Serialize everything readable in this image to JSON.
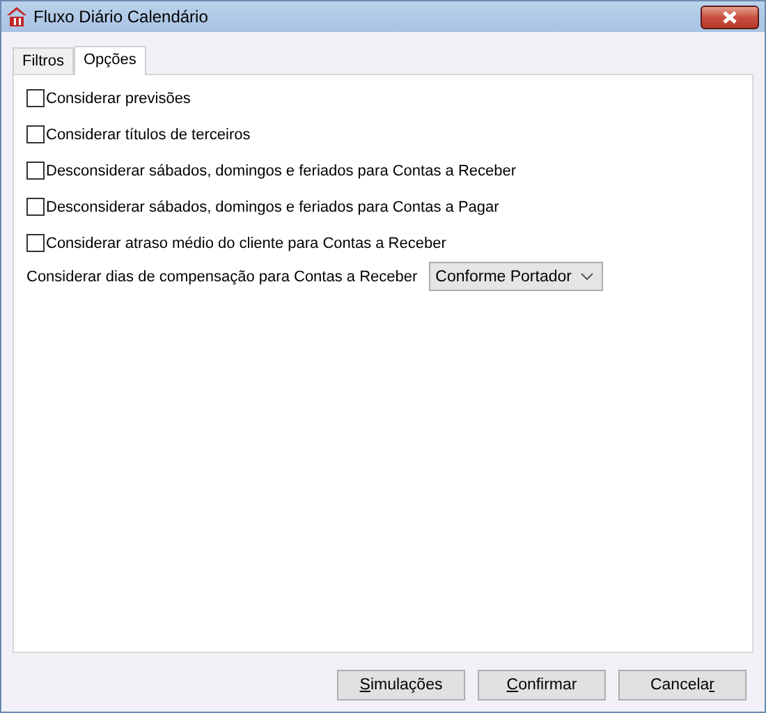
{
  "window": {
    "title": "Fluxo Diário Calendário"
  },
  "tabs": [
    {
      "label": "Filtros",
      "selected": false
    },
    {
      "label": "Opções",
      "selected": true
    }
  ],
  "options": [
    {
      "label": "Considerar previsões",
      "checked": false
    },
    {
      "label": "Considerar títulos de terceiros",
      "checked": false
    },
    {
      "label": "Desconsiderar sábados, domingos e feriados para Contas a Receber",
      "checked": false
    },
    {
      "label": "Desconsiderar sábados, domingos e feriados para Contas a Pagar",
      "checked": false
    },
    {
      "label": "Considerar atraso médio do cliente para Contas a Receber",
      "checked": false
    }
  ],
  "compensation": {
    "label": "Considerar dias de compensação para Contas a Receber",
    "value": "Conforme Portador"
  },
  "buttons": [
    {
      "access_key": "S",
      "after": "imulações"
    },
    {
      "access_key": "C",
      "after": "onfirmar"
    },
    {
      "before": "Cancela",
      "access_key": "r"
    }
  ]
}
